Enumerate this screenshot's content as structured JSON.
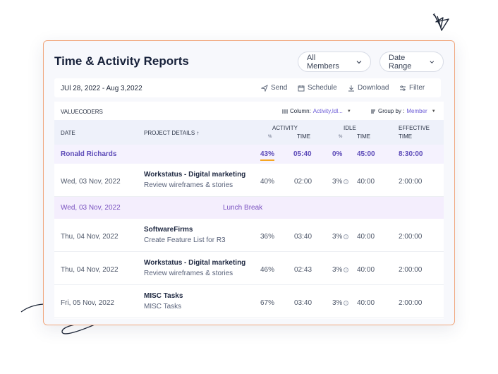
{
  "header": {
    "title": "Time & Activity Reports",
    "members_filter": "All Members",
    "date_filter": "Date Range"
  },
  "toolbar": {
    "date_range": "JUl 28, 2022 - Aug 3,2022",
    "send": "Send",
    "schedule": "Schedule",
    "download": "Download",
    "filter": "Filter"
  },
  "table_header": {
    "org": "VALUECODERS",
    "column_label": "Column:",
    "column_value": "Activity,Idl...",
    "group_label": "Group by :",
    "group_value": "Member"
  },
  "columns": {
    "date": "DATE",
    "project": "PROJECT DETAILS",
    "activity": "ACTIVITY",
    "activity_pct": "%",
    "activity_time": "TIME",
    "idle": "IDLE",
    "idle_pct": "%",
    "idle_time": "TIME",
    "effective": "EFFECTIVE",
    "effective_time": "TIME"
  },
  "user_row": {
    "name": "Ronald Richards",
    "activity_pct": "43%",
    "activity_time": "05:40",
    "idle_pct": "0%",
    "idle_time": "45:00",
    "effective_time": "8:30:00"
  },
  "entries": [
    {
      "date": "Wed, 03 Nov, 2022",
      "project": "Workstatus - Digital marketing",
      "task": "Review wireframes & stories",
      "activity_pct": "40%",
      "activity_time": "02:00",
      "idle_pct": "3%",
      "idle_time": "40:00",
      "effective_time": "2:00:00"
    },
    {
      "date": "Thu, 04 Nov, 2022",
      "project": "SoftwareFirms",
      "task": "Create Feature List for R3",
      "activity_pct": "36%",
      "activity_time": "03:40",
      "idle_pct": "3%",
      "idle_time": "40:00",
      "effective_time": "2:00:00"
    },
    {
      "date": "Thu, 04 Nov, 2022",
      "project": "Workstatus - Digital marketing",
      "task": "Review wireframes & stories",
      "activity_pct": "46%",
      "activity_time": "02:43",
      "idle_pct": "3%",
      "idle_time": "40:00",
      "effective_time": "2:00:00"
    },
    {
      "date": "Fri, 05 Nov, 2022",
      "project": "MISC Tasks",
      "task": "MISC Tasks",
      "activity_pct": "67%",
      "activity_time": "03:40",
      "idle_pct": "3%",
      "idle_time": "40:00",
      "effective_time": "2:00:00"
    }
  ],
  "break_row": {
    "date": "Wed, 03 Nov, 2022",
    "label": "Lunch Break"
  },
  "colors": {
    "accent": "#6a5ad6",
    "card_border": "#f1a87f",
    "highlight_underline": "#f5a623"
  }
}
